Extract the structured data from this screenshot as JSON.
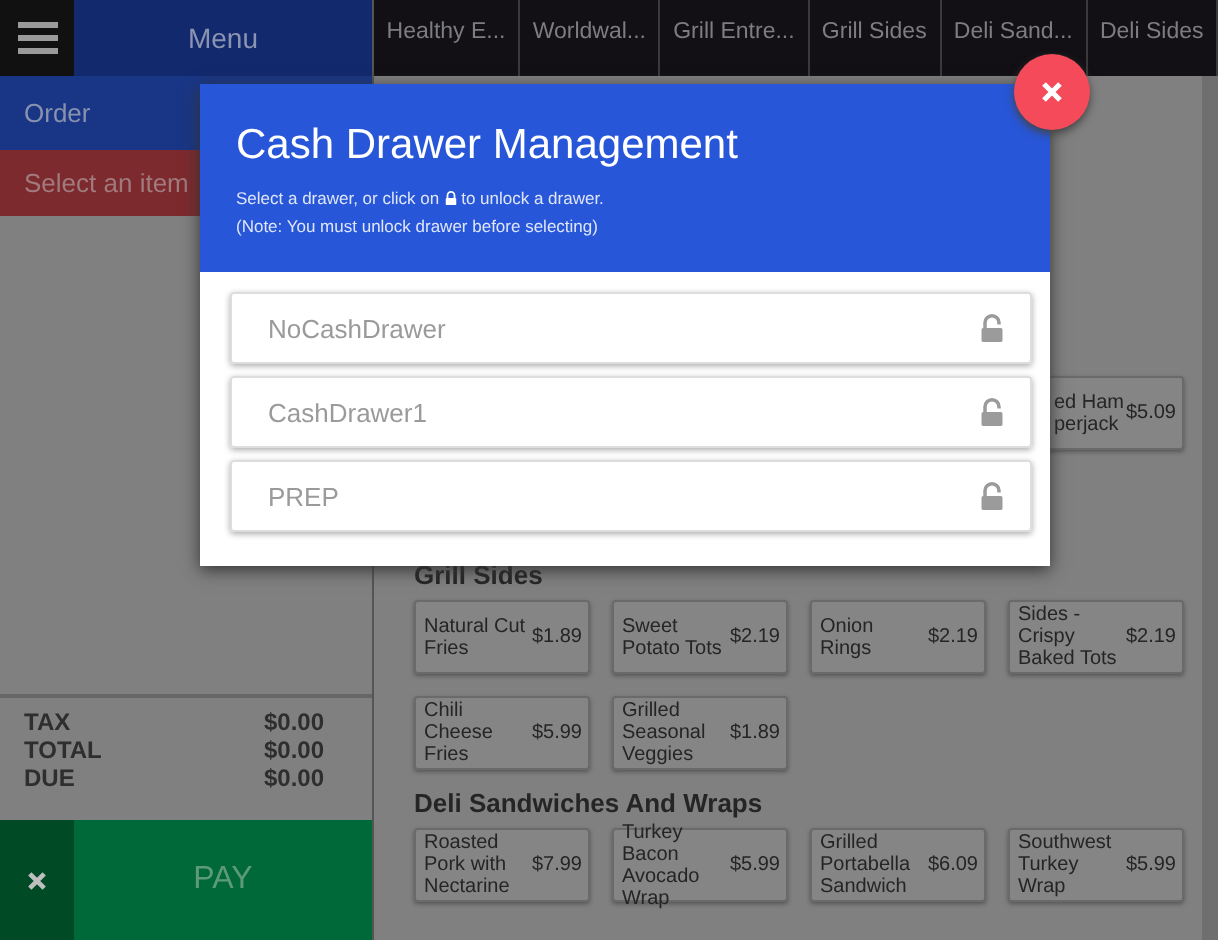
{
  "sidebar": {
    "menu_label": "Menu",
    "order_label": "Order",
    "prompt": "Select an item",
    "totals": [
      {
        "label": "TAX",
        "value": "$0.00"
      },
      {
        "label": "TOTAL",
        "value": "$0.00"
      },
      {
        "label": "DUE",
        "value": "$0.00"
      }
    ],
    "pay_label": "PAY"
  },
  "tabs": [
    "Healthy E...",
    "Worldwal...",
    "Grill Entre...",
    "Grill Sides",
    "Deli Sand...",
    "Deli Sides"
  ],
  "partial_item": {
    "lines": [
      "ed Ham",
      "perjack"
    ],
    "price": "$5.09"
  },
  "sections": [
    {
      "heading": "Grill Sides",
      "items": [
        {
          "name": "Natural Cut Fries",
          "price": "$1.89"
        },
        {
          "name": "Sweet Potato Tots",
          "price": "$2.19"
        },
        {
          "name": "Onion Rings",
          "price": "$2.19"
        },
        {
          "name": "Sides - Crispy Baked Tots",
          "price": "$2.19"
        },
        {
          "name": "Chili Cheese Fries",
          "price": "$5.99"
        },
        {
          "name": "Grilled Seasonal Veggies",
          "price": "$1.89"
        }
      ]
    },
    {
      "heading": "Deli Sandwiches And Wraps",
      "items": [
        {
          "name": "Roasted Pork with Nectarine",
          "price": "$7.99"
        },
        {
          "name": "Turkey Bacon Avocado Wrap",
          "price": "$5.99"
        },
        {
          "name": "Grilled Portabella Sandwich",
          "price": "$6.09"
        },
        {
          "name": "Southwest Turkey Wrap",
          "price": "$5.99"
        }
      ]
    }
  ],
  "dialog": {
    "title": "Cash Drawer Management",
    "hint_before": "Select a drawer, or click on",
    "hint_after": "to unlock a drawer.",
    "note": "(Note: You must unlock drawer before selecting)",
    "drawers": [
      {
        "name": "NoCashDrawer",
        "locked": false
      },
      {
        "name": "CashDrawer1",
        "locked": false
      },
      {
        "name": "PREP",
        "locked": false
      }
    ]
  }
}
